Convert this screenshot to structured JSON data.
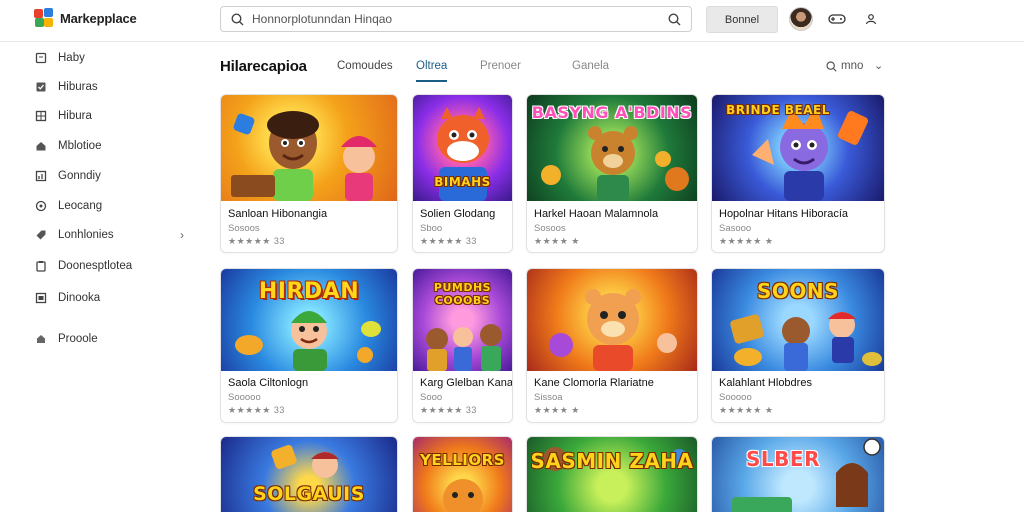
{
  "app": {
    "name": "Markepplace"
  },
  "search": {
    "placeholder": "Honnorplotunndan Hinqao"
  },
  "header": {
    "button_label": "Bonnel"
  },
  "sidebar": {
    "items": [
      {
        "label": "Haby",
        "icon": "bookmark-icon"
      },
      {
        "label": "Hiburas",
        "icon": "check-box-icon"
      },
      {
        "label": "Hibura",
        "icon": "grid-icon"
      },
      {
        "label": "Mblotioe",
        "icon": "home-icon"
      },
      {
        "label": "Gonndiy",
        "icon": "chart-icon"
      },
      {
        "label": "Leocang",
        "icon": "circle-icon"
      },
      {
        "label": "Lonhlonies",
        "icon": "tag-icon"
      },
      {
        "label": "Doonesptlotea",
        "icon": "clipboard-icon"
      },
      {
        "label": "Dinooka",
        "icon": "image-icon"
      },
      {
        "label": "Prooole",
        "icon": "lock-icon"
      }
    ]
  },
  "main": {
    "title": "Hilarecapioa",
    "tabs": [
      {
        "label": "Comoudes",
        "state": "normal"
      },
      {
        "label": "Oltrea",
        "state": "active"
      },
      {
        "label": "Prenoer",
        "state": "faded"
      },
      {
        "label": "Ganela",
        "state": "faded"
      }
    ],
    "sort_label": "mno",
    "cards": [
      {
        "title": "Sanloan Hibonangia",
        "subtitle": "Sosoos",
        "rating": "★★★★★ 33",
        "art_text": ""
      },
      {
        "title": "Solien Glodang",
        "subtitle": "Sboo",
        "rating": "★★★★★ 33",
        "art_text": "BIMAHS"
      },
      {
        "title": "Harkel Haoan Malamnola",
        "subtitle": "Sosoos",
        "rating": "★★★★ ★",
        "art_text": "BASYNG A'BDINS"
      },
      {
        "title": "Hopolnar Hitans Hiboracía",
        "subtitle": "Sasooo",
        "rating": "★★★★★ ★",
        "art_text": "BRINDE BEAEL"
      },
      {
        "title": "Saola Ciltonlogn",
        "subtitle": "Sooooo",
        "rating": "★★★★★ 33",
        "art_text": "HIRDAN"
      },
      {
        "title": "Karg Glelban Kana",
        "subtitle": "Sooo",
        "rating": "★★★★★ 33",
        "art_text": "PUMDHS COOOBS"
      },
      {
        "title": "Kane Clomorla Rlariatne",
        "subtitle": "Sissoa",
        "rating": "★★★★ ★",
        "art_text": ""
      },
      {
        "title": "Kalahlant Hlobdres",
        "subtitle": "Sooooo",
        "rating": "★★★★★ ★",
        "art_text": "SOONS"
      },
      {
        "title": "",
        "subtitle": "",
        "rating": "",
        "art_text": "SOLGAUIS"
      },
      {
        "title": "",
        "subtitle": "",
        "rating": "",
        "art_text": "YELLIORS"
      },
      {
        "title": "",
        "subtitle": "",
        "rating": "",
        "art_text": "SASMIN ZAHA"
      },
      {
        "title": "",
        "subtitle": "",
        "rating": "",
        "art_text": "SLBER"
      }
    ]
  },
  "colors": {
    "accent": "#1a5e86",
    "card_border": "#e2e2e2",
    "topbar_button": "#e9e9e9"
  }
}
